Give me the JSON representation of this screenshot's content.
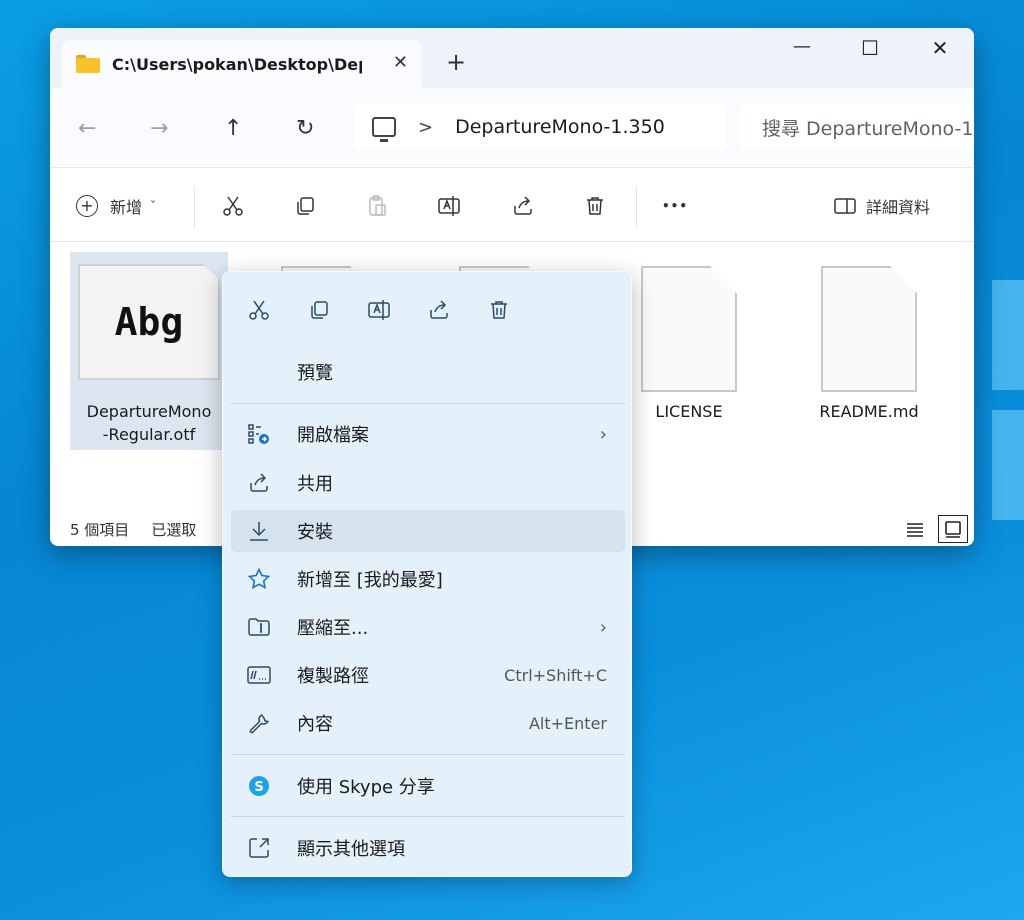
{
  "window": {
    "tab_title": "C:\\Users\\pokan\\Desktop\\Depa",
    "tab_close": "✕",
    "tab_add": "+",
    "minimize": "—",
    "maximize": "☐",
    "close": "✕"
  },
  "nav": {
    "back": "←",
    "forward": "→",
    "up": "↑",
    "refresh": "↻",
    "breadcrumb_chevron": ">",
    "address": "DepartureMono-1.350",
    "search_placeholder": "搜尋 DepartureMono-1"
  },
  "toolbar": {
    "new_label": "新增",
    "new_chevron": "˅",
    "more": "•••",
    "details_label": "詳細資料"
  },
  "files": [
    {
      "name": "DepartureMono-Regular.otf",
      "line1": "DepartureMono",
      "line2": "-Regular.otf",
      "thumb_text": "Abg",
      "selected": true
    },
    {
      "name": "",
      "selected": false
    },
    {
      "name": "",
      "selected": false
    },
    {
      "name": "LICENSE",
      "selected": false
    },
    {
      "name": "README.md",
      "selected": false
    }
  ],
  "status": {
    "item_count": "5 個項目",
    "selected": "已選取"
  },
  "context_menu": {
    "quick_actions": [
      "cut-icon",
      "copy-icon",
      "rename-icon",
      "share-icon",
      "delete-icon"
    ],
    "items": [
      {
        "label": "預覽",
        "icon": "",
        "shortcut": "",
        "submenu": false
      },
      {
        "label": "開啟檔案",
        "icon": "open-with-icon",
        "shortcut": "",
        "submenu": true
      },
      {
        "label": "共用",
        "icon": "share-icon",
        "shortcut": "",
        "submenu": false
      },
      {
        "label": "安裝",
        "icon": "install-icon",
        "shortcut": "",
        "submenu": false
      },
      {
        "label": "新增至 [我的最愛]",
        "icon": "star-icon",
        "shortcut": "",
        "submenu": false
      },
      {
        "label": "壓縮至...",
        "icon": "zip-folder-icon",
        "shortcut": "",
        "submenu": true
      },
      {
        "label": "複製路徑",
        "icon": "copy-path-icon",
        "shortcut": "Ctrl+Shift+C",
        "submenu": false
      },
      {
        "label": "內容",
        "icon": "wrench-icon",
        "shortcut": "Alt+Enter",
        "submenu": false
      },
      {
        "label": "使用 Skype 分享",
        "icon": "skype-icon",
        "shortcut": "",
        "submenu": false
      },
      {
        "label": "顯示其他選項",
        "icon": "more-options-icon",
        "shortcut": "",
        "submenu": false
      }
    ],
    "submenu_arrow": "›"
  },
  "colors": {
    "desktop_blue": "#0a8fdd",
    "folder_yellow": "#f8c22a",
    "accent_blue": "#1a73c8",
    "skype_blue": "#1fa2e6"
  }
}
